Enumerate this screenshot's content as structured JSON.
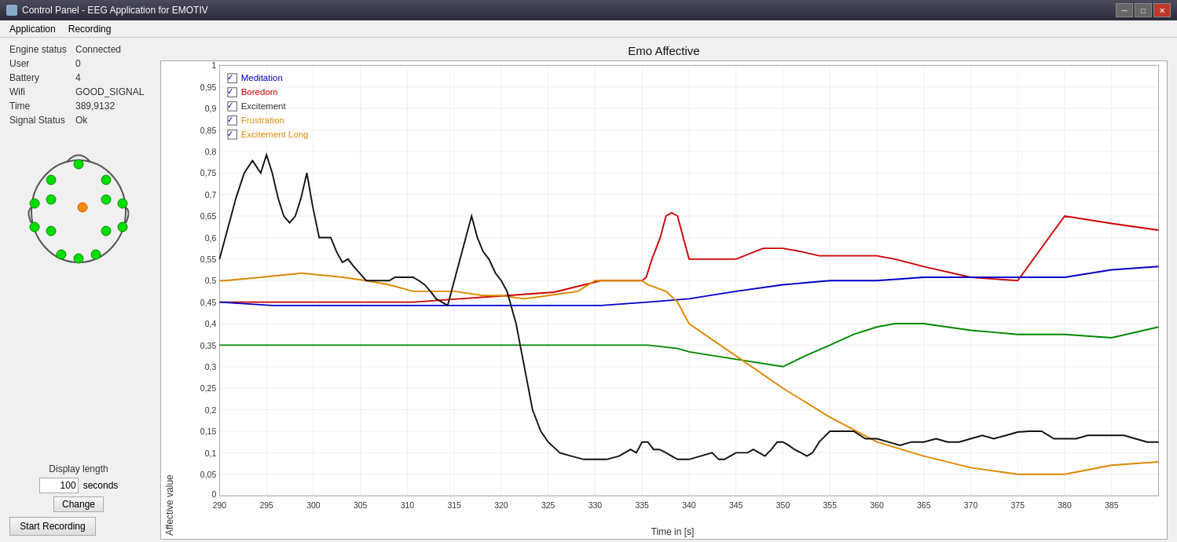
{
  "titleBar": {
    "icon": "app-icon",
    "title": "Control Panel - EEG Application for EMOTIV",
    "minimizeLabel": "─",
    "maximizeLabel": "□",
    "closeLabel": "✕"
  },
  "menuBar": {
    "items": [
      {
        "label": "Application",
        "id": "menu-application"
      },
      {
        "label": "Recording",
        "id": "menu-recording"
      }
    ]
  },
  "infoPanel": {
    "rows": [
      {
        "label": "Engine status",
        "value": "Connected"
      },
      {
        "label": "User",
        "value": "0"
      },
      {
        "label": "Battery",
        "value": "4"
      },
      {
        "label": "Wifi",
        "value": "GOOD_SIGNAL"
      },
      {
        "label": "Time",
        "value": "389,9132"
      },
      {
        "label": "Signal Status",
        "value": "Ok"
      }
    ]
  },
  "legend": {
    "items": [
      {
        "label": "Meditation",
        "color": "#0000cc",
        "checked": true
      },
      {
        "label": "Boredom",
        "color": "#cc0000",
        "checked": true
      },
      {
        "label": "Excitement",
        "color": "#000000",
        "checked": true
      },
      {
        "label": "Frustration",
        "color": "#dd8800",
        "checked": true
      },
      {
        "label": "Excitement Long",
        "color": "#dd8800",
        "checked": true
      }
    ]
  },
  "chart": {
    "title": "Emo Affective",
    "yAxisLabel": "Affective value",
    "xAxisLabel": "Time in [s]",
    "yTicks": [
      "1",
      "0,95",
      "0,9",
      "0,85",
      "0,8",
      "0,75",
      "0,7",
      "0,65",
      "0,6",
      "0,55",
      "0,5",
      "0,45",
      "0,4",
      "0,35",
      "0,3",
      "0,25",
      "0,2",
      "0,15",
      "0,1",
      "0,05",
      "0"
    ],
    "xTicks": [
      "290",
      "295",
      "300",
      "305",
      "310",
      "315",
      "320",
      "325",
      "330",
      "335",
      "340",
      "345",
      "350",
      "355",
      "360",
      "365",
      "370",
      "375",
      "380",
      "385",
      ""
    ]
  },
  "displayLength": {
    "label": "Display length",
    "value": "100",
    "unit": "seconds",
    "changeButtonLabel": "Change"
  },
  "startRecordingButton": {
    "label": "Start Recording"
  }
}
